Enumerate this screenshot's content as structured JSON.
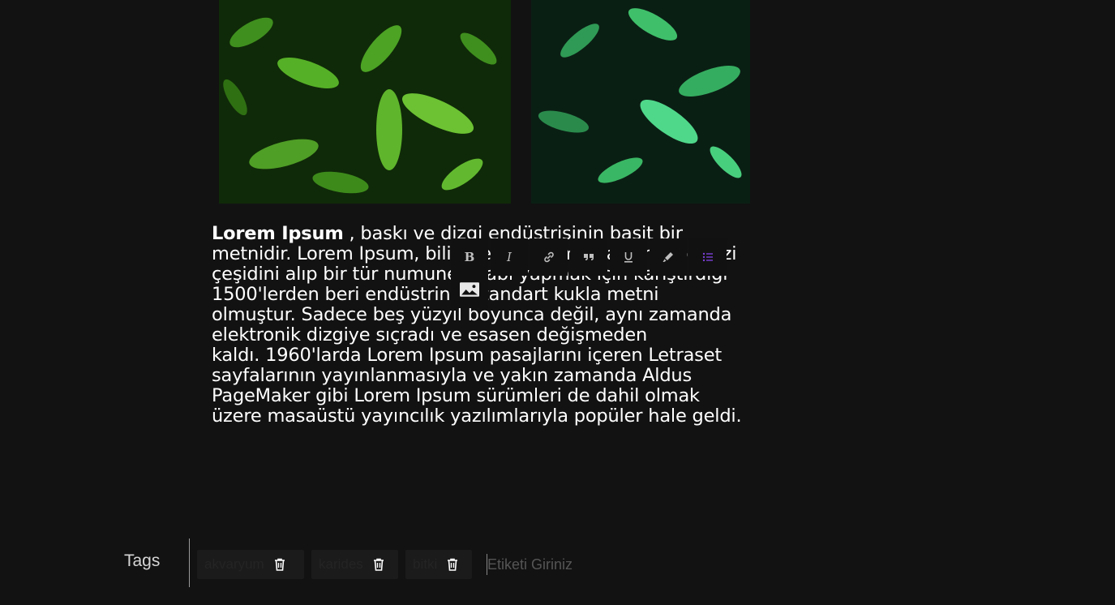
{
  "images": [
    {
      "alt": "aquarium-plants-image-1"
    },
    {
      "alt": "aquarium-plants-image-2"
    }
  ],
  "article": {
    "bold_lead": "Lorem Ipsum",
    "lines": [
      " , baskı ve dizgi endüstrisinin basit bir",
      "metnidir. Lorem Ipsum, bilinmeyen bir matbaacının bir dizi",
      "çeşidini alıp bir tür numune kitabı yapmak için karıştırdığı",
      "1500'lerden beri endüstrinin standart kukla metni",
      "olmuştur. Sadece beş yüzyıl boyunca değil, aynı zamanda",
      "elektronik dizgiye sıçradı ve esasen değişmeden",
      "kaldı. 1960'larda Lorem Ipsum pasajlarını içeren Letraset",
      "sayfalarının yayınlanmasıyla ve yakın zamanda Aldus",
      "PageMaker gibi Lorem Ipsum sürümleri de dahil olmak",
      "üzere masaüstü yayıncılık yazılımlarıyla popüler hale geldi."
    ]
  },
  "toolbar": {
    "bold": "B",
    "italic": "I",
    "icons": [
      "bold-icon",
      "italic-icon",
      "link-icon",
      "quote-icon",
      "underline-icon",
      "highlight-icon",
      "list-icon",
      "image-icon"
    ],
    "active_color": "#7b3fd6"
  },
  "tags": {
    "label": "Tags",
    "items": [
      "akvaryum",
      "karides",
      "bitki"
    ],
    "input_placeholder": "Etiketi Giriniz"
  }
}
